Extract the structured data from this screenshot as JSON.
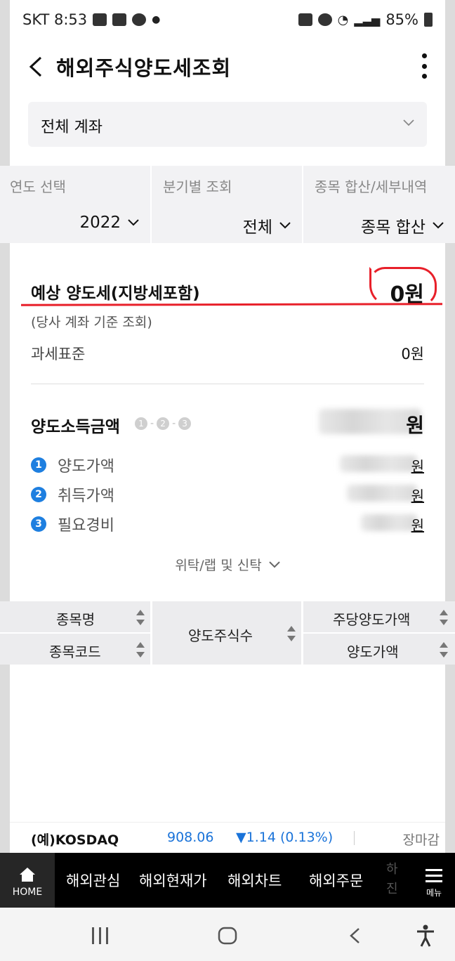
{
  "status_bar": {
    "carrier_time": "SKT 8:53",
    "battery": "85%",
    "icons": [
      "image-icon",
      "v-icon",
      "talk-icon",
      "dot-icon",
      "recycle-icon",
      "alarm-icon",
      "wifi-icon",
      "signal-icon",
      "battery-icon"
    ]
  },
  "header": {
    "title": "해외주식양도세조회"
  },
  "account": {
    "label": "전체 계좌"
  },
  "filters": [
    {
      "label": "연도 선택",
      "value": "2022"
    },
    {
      "label": "분기별 조회",
      "value": "전체"
    },
    {
      "label": "종목 합산/세부내역",
      "value": "종목 합산"
    }
  ],
  "tax": {
    "estimated_label": "예상 양도세(지방세포함)",
    "estimated_value": "0원",
    "note": "(당사 계좌 기준 조회)",
    "taxbase_label": "과세표준",
    "taxbase_value": "0원"
  },
  "income": {
    "title": "양도소득금액",
    "steps": [
      "1",
      "2",
      "3"
    ],
    "total_suffix": "원",
    "items": [
      {
        "num": "1",
        "label": "양도가액",
        "suffix": "원"
      },
      {
        "num": "2",
        "label": "취득가액",
        "suffix": "원"
      },
      {
        "num": "3",
        "label": "필요경비",
        "suffix": "원"
      }
    ],
    "trust_label": "위탁/랩 및 신탁"
  },
  "table_header": {
    "col1_top": "종목명",
    "col1_bottom": "종목코드",
    "col2": "양도주식수",
    "col3_top": "주당양도가액",
    "col3_bottom": "양도가액"
  },
  "ticker": {
    "name": "(예)KOSDAQ",
    "value": "908.06",
    "change": "▼1.14 (0.13%)",
    "status": "장마감"
  },
  "bottom_nav": {
    "home": "HOME",
    "items": [
      "해외관심",
      "해외현재가",
      "해외차트",
      "해외주문"
    ],
    "partial": "하\n진",
    "menu": "메뉴"
  },
  "colors": {
    "accent_blue": "#1e7fe0",
    "annotation_red": "#e8202a",
    "nav_bg": "#000000"
  }
}
